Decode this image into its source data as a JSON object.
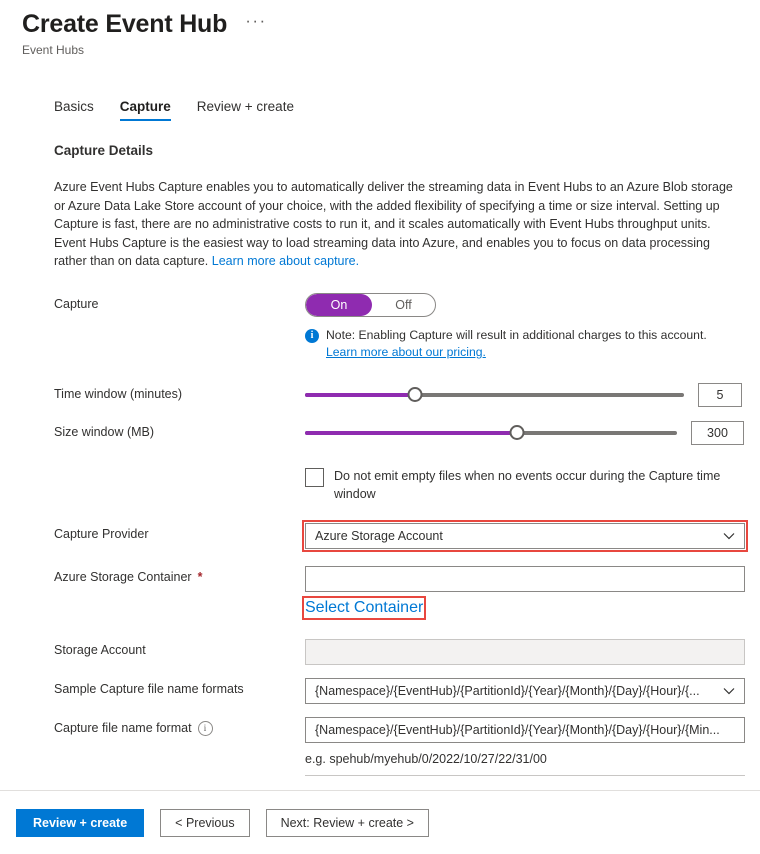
{
  "header": {
    "title": "Create Event Hub",
    "subtitle": "Event Hubs",
    "more_label": "···"
  },
  "tabs": [
    {
      "label": "Basics",
      "active": false
    },
    {
      "label": "Capture",
      "active": true
    },
    {
      "label": "Review + create",
      "active": false
    }
  ],
  "section": {
    "title": "Capture Details",
    "description_text": "Azure Event Hubs Capture enables you to automatically deliver the streaming data in Event Hubs to an Azure Blob storage or Azure Data Lake Store account of your choice, with the added flexibility of specifying a time or size interval. Setting up Capture is fast, there are no administrative costs to run it, and it scales automatically with Event Hubs throughput units. Event Hubs Capture is the easiest way to load streaming data into Azure, and enables you to focus on data processing rather than on data capture.",
    "description_link": "Learn more about capture."
  },
  "capture": {
    "label": "Capture",
    "toggle_on": "On",
    "toggle_off": "Off",
    "state": "On",
    "note_text": "Note: Enabling Capture will result in additional charges to this account.",
    "note_link": "Learn more about our pricing.",
    "info_glyph": "i"
  },
  "time_window": {
    "label": "Time window (minutes)",
    "value": "5",
    "percent": 29,
    "min": 1,
    "max": 15
  },
  "size_window": {
    "label": "Size window (MB)",
    "value": "300",
    "percent": 57,
    "min": 10,
    "max": 500
  },
  "empty_files": {
    "label": "Do not emit empty files when no events occur during the Capture time window",
    "checked": false
  },
  "capture_provider": {
    "label": "Capture Provider",
    "value": "Azure Storage Account",
    "highlighted": true
  },
  "storage_container": {
    "label": "Azure Storage Container",
    "required_marker": "*",
    "value": "",
    "select_link": "Select Container",
    "link_highlighted": true
  },
  "storage_account": {
    "label": "Storage Account",
    "value": "",
    "disabled": true
  },
  "sample_format": {
    "label": "Sample Capture file name formats",
    "value": "{Namespace}/{EventHub}/{PartitionId}/{Year}/{Month}/{Day}/{Hour}/{..."
  },
  "capture_format": {
    "label": "Capture file name format",
    "value": "{Namespace}/{EventHub}/{PartitionId}/{Year}/{Month}/{Day}/{Hour}/{Min...",
    "example": "e.g. spehub/myehub/0/2022/10/27/22/31/00",
    "info_glyph": "i"
  },
  "footer": {
    "review_create": "Review + create",
    "previous": "< Previous",
    "next": "Next: Review + create >"
  },
  "colors": {
    "accent_blue": "#0078d4",
    "toggle_purple": "#8f2bb0",
    "highlight_red": "#e8473f",
    "required_red": "#a4262c"
  }
}
